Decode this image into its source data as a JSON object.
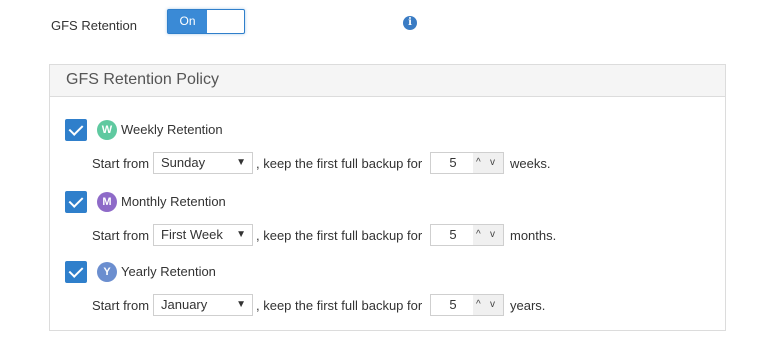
{
  "gfs": {
    "label": "GFS Retention",
    "toggle_on_label": "On",
    "enabled": true,
    "info_icon": "info-icon"
  },
  "panel": {
    "title": "GFS Retention Policy",
    "start_from_label": "Start from",
    "keep_text": ", keep the first full backup for",
    "items": [
      {
        "id": "weekly",
        "checked": true,
        "badge": "W",
        "badge_color": "#5fc9a0",
        "label": "Weekly Retention",
        "start_value": "Sunday",
        "count": "5",
        "unit": "weeks."
      },
      {
        "id": "monthly",
        "checked": true,
        "badge": "M",
        "badge_color": "#8e6ac8",
        "label": "Monthly Retention",
        "start_value": "First Week",
        "count": "5",
        "unit": "months."
      },
      {
        "id": "yearly",
        "checked": true,
        "badge": "Y",
        "badge_color": "#6b8ecf",
        "label": "Yearly Retention",
        "start_value": "January",
        "count": "5",
        "unit": "years."
      }
    ]
  },
  "colors": {
    "accent": "#3a8ad6",
    "checkbox": "#2f7fcb"
  }
}
